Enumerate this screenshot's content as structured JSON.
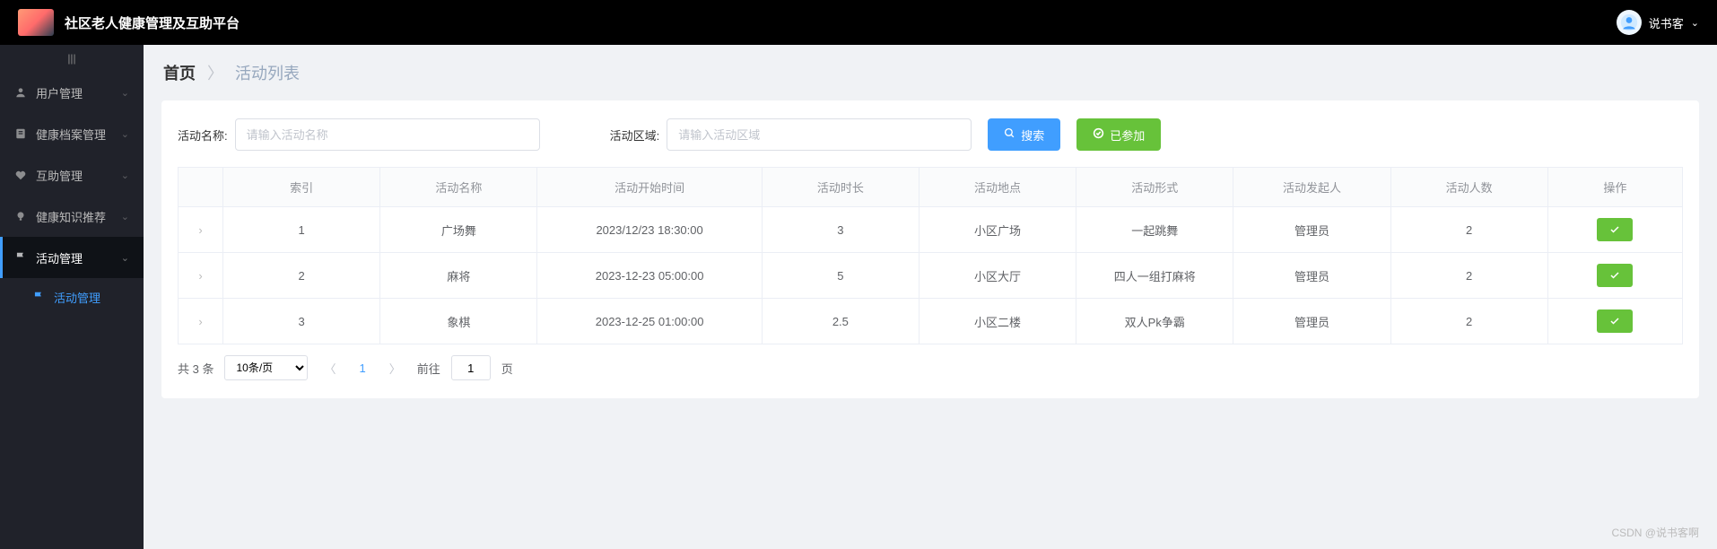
{
  "app": {
    "title": "社区老人健康管理及互助平台"
  },
  "user": {
    "name": "说书客"
  },
  "sidebar": {
    "items": [
      {
        "label": "用户管理"
      },
      {
        "label": "健康档案管理"
      },
      {
        "label": "互助管理"
      },
      {
        "label": "健康知识推荐"
      },
      {
        "label": "活动管理"
      }
    ],
    "subitem": {
      "label": "活动管理"
    }
  },
  "breadcrumb": {
    "home": "首页",
    "current": "活动列表"
  },
  "filter": {
    "name_label": "活动名称:",
    "name_placeholder": "请输入活动名称",
    "region_label": "活动区域:",
    "region_placeholder": "请输入活动区域",
    "search_btn": "搜索",
    "joined_btn": "已参加"
  },
  "table": {
    "headers": [
      "",
      "索引",
      "活动名称",
      "活动开始时间",
      "活动时长",
      "活动地点",
      "活动形式",
      "活动发起人",
      "活动人数",
      "操作"
    ],
    "rows": [
      {
        "index": "1",
        "name": "广场舞",
        "start": "2023/12/23 18:30:00",
        "duration": "3",
        "place": "小区广场",
        "form": "一起跳舞",
        "creator": "管理员",
        "count": "2"
      },
      {
        "index": "2",
        "name": "麻将",
        "start": "2023-12-23 05:00:00",
        "duration": "5",
        "place": "小区大厅",
        "form": "四人一组打麻将",
        "creator": "管理员",
        "count": "2"
      },
      {
        "index": "3",
        "name": "象棋",
        "start": "2023-12-25 01:00:00",
        "duration": "2.5",
        "place": "小区二楼",
        "form": "双人Pk争霸",
        "creator": "管理员",
        "count": "2"
      }
    ]
  },
  "pagination": {
    "total": "共 3 条",
    "page_size": "10条/页",
    "current": "1",
    "goto_label": "前往",
    "goto_value": "1",
    "page_suffix": "页"
  },
  "watermark": "CSDN @说书客啊"
}
